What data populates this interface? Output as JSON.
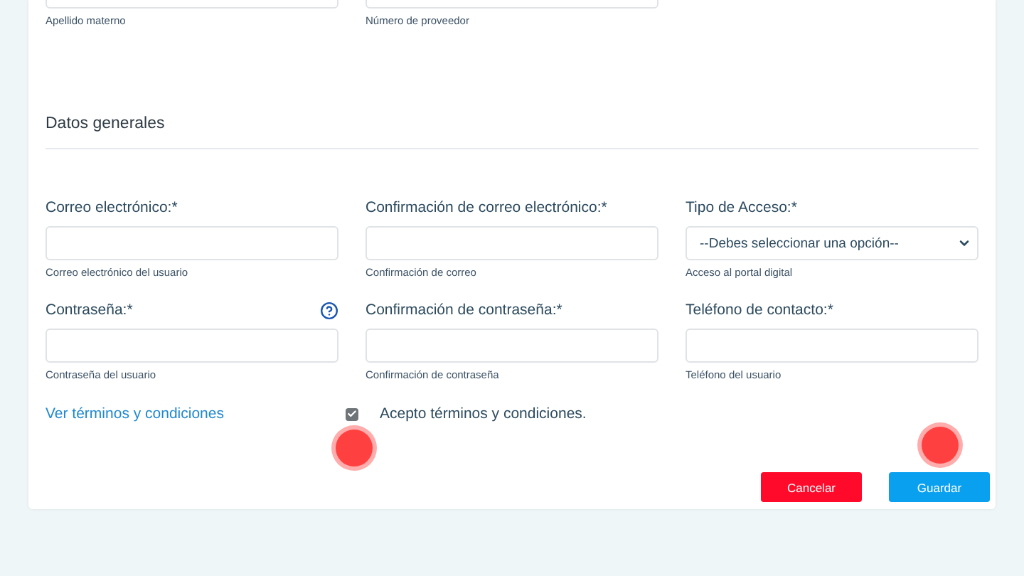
{
  "top_fields": [
    {
      "hint": "Apellido materno"
    },
    {
      "hint": "Número de proveedor"
    }
  ],
  "section": {
    "title": "Datos generales"
  },
  "fields": [
    {
      "kind": "input",
      "label": "Correo electrónico:*",
      "hint": "Correo electrónico del usuario",
      "help": false
    },
    {
      "kind": "input",
      "label": "Confirmación de correo electrónico:*",
      "hint": "Confirmación de correo",
      "help": false
    },
    {
      "kind": "select",
      "label": "Tipo de Acceso:*",
      "value": "--Debes seleccionar una opción--",
      "hint": "Acceso al portal digital",
      "help": false
    },
    {
      "kind": "input",
      "label": "Contraseña:*",
      "hint": "Contraseña del usuario",
      "help": true
    },
    {
      "kind": "input",
      "label": "Confirmación de contraseña:*",
      "hint": "Confirmación de contraseña",
      "help": false
    },
    {
      "kind": "input",
      "label": "Teléfono de contacto:*",
      "hint": "Teléfono del usuario",
      "help": false
    }
  ],
  "terms_link": "Ver términos y condiciones",
  "accept": {
    "label": "Acepto términos y condiciones.",
    "checked": true,
    "touch_indicator": true
  },
  "buttons": [
    {
      "kind": "cancel",
      "label": "Cancelar",
      "touch_indicator": false
    },
    {
      "kind": "save",
      "label": "Guardar",
      "touch_indicator": true
    }
  ]
}
